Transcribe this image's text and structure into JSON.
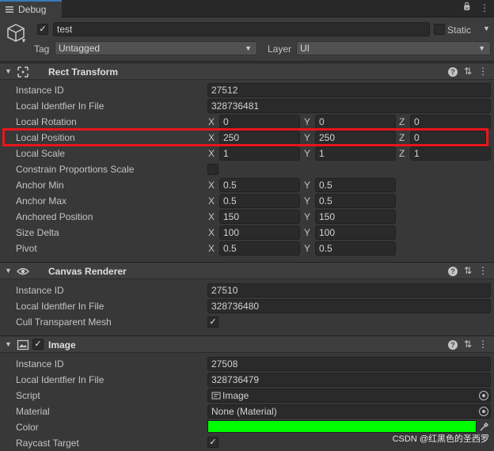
{
  "window": {
    "tab_label": "Debug",
    "tab_icon": "hamburger-icon",
    "right_icons": [
      "lock-icon",
      "more-vert-icon"
    ],
    "lock_glyph": "🔒",
    "menu_glyph": "⋮"
  },
  "object": {
    "name": "test",
    "active": true,
    "static_label": "Static",
    "tag_label": "Tag",
    "tag_value": "Untagged",
    "layer_label": "Layer",
    "layer_value": "UI",
    "arrow": "▼"
  },
  "components": {
    "rect_transform": {
      "title": "Rect Transform",
      "rows": {
        "instance_id": {
          "label": "Instance ID",
          "value": "27512"
        },
        "local_id": {
          "label": "Local Identfier In File",
          "value": "328736481"
        },
        "local_rotation": {
          "label": "Local Rotation",
          "x": "0",
          "y": "0",
          "z": "0"
        },
        "local_position": {
          "label": "Local Position",
          "x": "250",
          "y": "250",
          "z": "0"
        },
        "local_scale": {
          "label": "Local Scale",
          "x": "1",
          "y": "1",
          "z": "1"
        },
        "constrain": {
          "label": "Constrain Proportions Scale",
          "checked": false
        },
        "anchor_min": {
          "label": "Anchor Min",
          "x": "0.5",
          "y": "0.5"
        },
        "anchor_max": {
          "label": "Anchor Max",
          "x": "0.5",
          "y": "0.5"
        },
        "anchored_position": {
          "label": "Anchored Position",
          "x": "150",
          "y": "150"
        },
        "size_delta": {
          "label": "Size Delta",
          "x": "100",
          "y": "100"
        },
        "pivot": {
          "label": "Pivot",
          "x": "0.5",
          "y": "0.5"
        }
      }
    },
    "canvas_renderer": {
      "title": "Canvas Renderer",
      "rows": {
        "instance_id": {
          "label": "Instance ID",
          "value": "27510"
        },
        "local_id": {
          "label": "Local Identfier In File",
          "value": "328736480"
        },
        "cull": {
          "label": "Cull Transparent Mesh",
          "checked": true
        }
      }
    },
    "image": {
      "title": "Image",
      "enabled": true,
      "rows": {
        "instance_id": {
          "label": "Instance ID",
          "value": "27508"
        },
        "local_id": {
          "label": "Local Identfier In File",
          "value": "328736479"
        },
        "script": {
          "label": "Script",
          "value": "Image"
        },
        "material": {
          "label": "Material",
          "value": "None (Material)"
        },
        "color": {
          "label": "Color",
          "value": "#00ff00"
        },
        "raycast": {
          "label": "Raycast Target",
          "checked": true
        }
      }
    }
  },
  "axes": {
    "x": "X",
    "y": "Y",
    "z": "Z"
  },
  "glyphs": {
    "check": "✓",
    "fold": "▼",
    "help": "?",
    "settings": "⇅",
    "more": "⋮"
  },
  "watermark": "CSDN @红黑色的圣西罗",
  "colors": {
    "highlight": "#e8161b",
    "tab_accent": "#3a79bb",
    "image_color": "#00ff00"
  }
}
